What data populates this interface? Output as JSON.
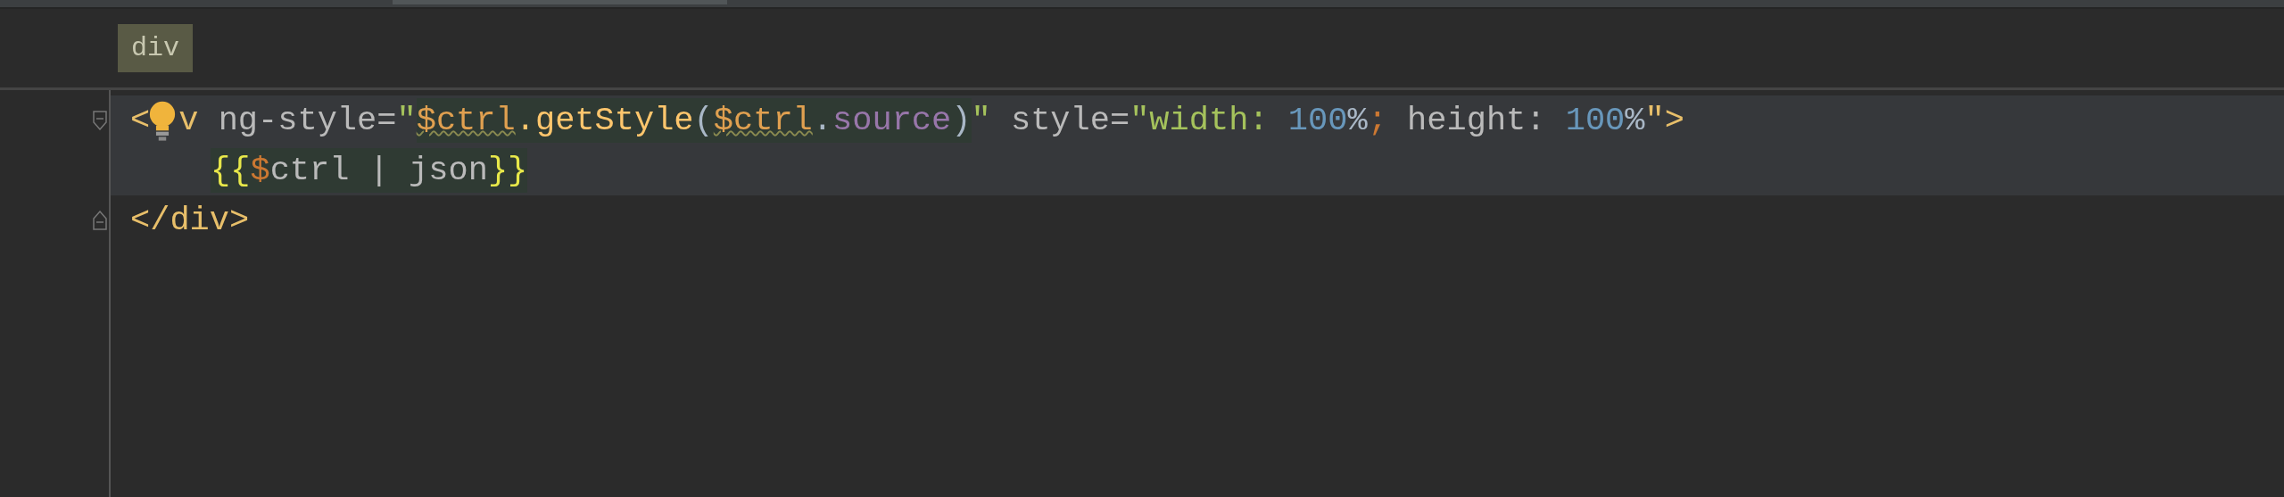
{
  "breadcrumb": [
    {
      "label": "div",
      "selected": true
    }
  ],
  "lines": [
    {
      "highlighted": true,
      "kind": "fold-start",
      "bulb": true,
      "tokens": [
        {
          "text": "<",
          "kind": "tag"
        },
        {
          "text": "v",
          "kind": "tag"
        },
        {
          "text": " ng-style=",
          "kind": "attr"
        },
        {
          "text": "\"",
          "kind": "string"
        },
        {
          "text": "$ctrl",
          "kind": "var",
          "squiggly": true,
          "injected": true
        },
        {
          "text": ".getStyle",
          "kind": "func",
          "injected": true
        },
        {
          "text": "(",
          "kind": "punct",
          "injected": true
        },
        {
          "text": "$ctrl",
          "kind": "var",
          "squiggly": true,
          "injected": true
        },
        {
          "text": ".",
          "kind": "punct",
          "injected": true
        },
        {
          "text": "source",
          "kind": "prop",
          "injected": true
        },
        {
          "text": ")",
          "kind": "punct",
          "injected": true
        },
        {
          "text": "\"",
          "kind": "string"
        },
        {
          "text": " style=",
          "kind": "attr"
        },
        {
          "text": "\"width: ",
          "kind": "string"
        },
        {
          "text": "100",
          "kind": "number"
        },
        {
          "text": "%",
          "kind": "punct"
        },
        {
          "text": "; ",
          "kind": "keyword"
        },
        {
          "text": "height: ",
          "kind": "attr"
        },
        {
          "text": "100",
          "kind": "number"
        },
        {
          "text": "%",
          "kind": "punct"
        },
        {
          "text": "\">",
          "kind": "tag"
        }
      ],
      "children": [
        {
          "highlighted": true,
          "bulb": false,
          "tokens": [
            {
              "text": "{{",
              "kind": "brace",
              "injected": true
            },
            {
              "text": "$",
              "kind": "keyword",
              "injected": true
            },
            {
              "text": "ctrl | json",
              "kind": "attr",
              "injected": true
            },
            {
              "text": "}}",
              "kind": "brace",
              "injected": true
            }
          ]
        }
      ]
    },
    {
      "highlighted": false,
      "kind": "fold-end",
      "bulb": false,
      "tokens": [
        {
          "text": "</div>",
          "kind": "tag"
        }
      ]
    }
  ]
}
